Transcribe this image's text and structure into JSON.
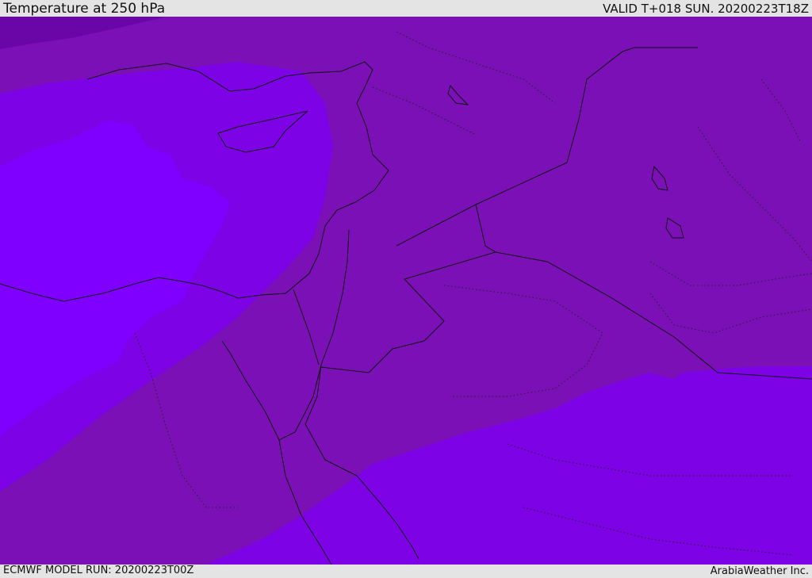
{
  "header": {
    "title": "Temperature at 250 hPa",
    "valid": "VALID T+018 SUN. 20200223T18Z"
  },
  "footer": {
    "model_run": "ECMWF MODEL RUN: 20200223T00Z",
    "credit": "ArabiaWeather Inc."
  },
  "map": {
    "colors": {
      "deep_band": "#6a05a8",
      "main_band": "#7a10b6",
      "mid_band": "#7d02e6",
      "cold_core": "#8000ff",
      "border": "#111111"
    }
  }
}
